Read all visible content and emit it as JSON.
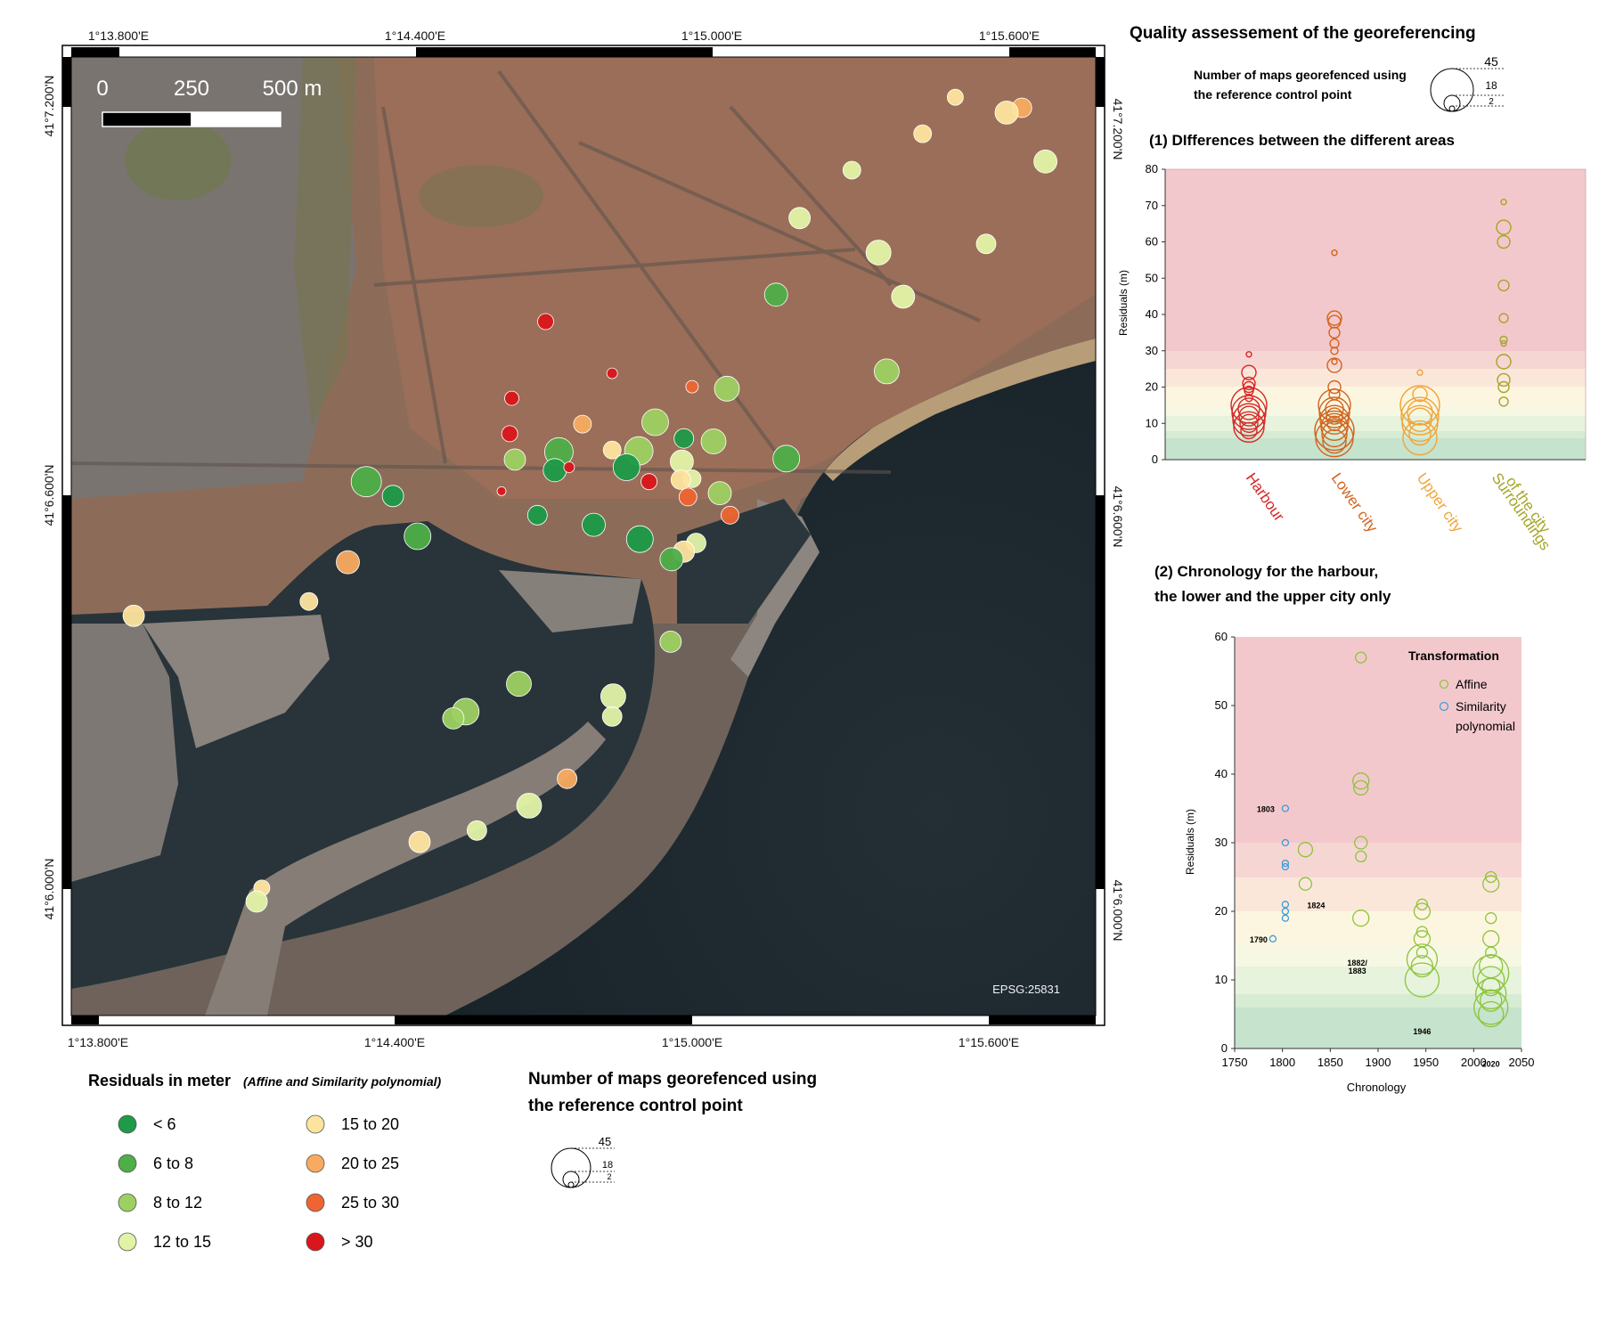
{
  "map": {
    "crs_label": "EPSG:25831",
    "lon_ticks": [
      "1°13.800'E",
      "1°14.400'E",
      "1°15.000'E",
      "1°15.600'E"
    ],
    "lat_ticks": [
      "41°7.200'N",
      "41°6.600'N",
      "41°6.000'N"
    ],
    "scalebar": {
      "labels": [
        "0",
        "250",
        "500 m"
      ]
    },
    "points": [
      {
        "x": 0.863,
        "y": 0.042,
        "c": 4
      },
      {
        "x": 0.928,
        "y": 0.053,
        "c": 5
      },
      {
        "x": 0.913,
        "y": 0.058,
        "c": 4
      },
      {
        "x": 0.831,
        "y": 0.08,
        "c": 4
      },
      {
        "x": 0.951,
        "y": 0.109,
        "c": 3
      },
      {
        "x": 0.762,
        "y": 0.118,
        "c": 3
      },
      {
        "x": 0.711,
        "y": 0.168,
        "c": 3
      },
      {
        "x": 0.788,
        "y": 0.204,
        "c": 3
      },
      {
        "x": 0.893,
        "y": 0.195,
        "c": 3
      },
      {
        "x": 0.812,
        "y": 0.25,
        "c": 3
      },
      {
        "x": 0.688,
        "y": 0.248,
        "c": 1
      },
      {
        "x": 0.796,
        "y": 0.328,
        "c": 2
      },
      {
        "x": 0.463,
        "y": 0.276,
        "c": 7
      },
      {
        "x": 0.528,
        "y": 0.33,
        "c": 7
      },
      {
        "x": 0.43,
        "y": 0.356,
        "c": 7
      },
      {
        "x": 0.606,
        "y": 0.344,
        "c": 6
      },
      {
        "x": 0.64,
        "y": 0.346,
        "c": 2
      },
      {
        "x": 0.428,
        "y": 0.393,
        "c": 7
      },
      {
        "x": 0.499,
        "y": 0.383,
        "c": 5
      },
      {
        "x": 0.57,
        "y": 0.381,
        "c": 2
      },
      {
        "x": 0.598,
        "y": 0.398,
        "c": 0
      },
      {
        "x": 0.627,
        "y": 0.401,
        "c": 2
      },
      {
        "x": 0.554,
        "y": 0.411,
        "c": 2
      },
      {
        "x": 0.528,
        "y": 0.41,
        "c": 4
      },
      {
        "x": 0.476,
        "y": 0.412,
        "c": 1
      },
      {
        "x": 0.433,
        "y": 0.42,
        "c": 2
      },
      {
        "x": 0.472,
        "y": 0.431,
        "c": 0
      },
      {
        "x": 0.542,
        "y": 0.428,
        "c": 0
      },
      {
        "x": 0.486,
        "y": 0.428,
        "c": 7
      },
      {
        "x": 0.596,
        "y": 0.422,
        "c": 3
      },
      {
        "x": 0.606,
        "y": 0.44,
        "c": 3
      },
      {
        "x": 0.595,
        "y": 0.441,
        "c": 4
      },
      {
        "x": 0.564,
        "y": 0.443,
        "c": 7
      },
      {
        "x": 0.633,
        "y": 0.455,
        "c": 2
      },
      {
        "x": 0.602,
        "y": 0.459,
        "c": 6
      },
      {
        "x": 0.42,
        "y": 0.453,
        "c": 7
      },
      {
        "x": 0.698,
        "y": 0.419,
        "c": 1
      },
      {
        "x": 0.288,
        "y": 0.443,
        "c": 1
      },
      {
        "x": 0.314,
        "y": 0.458,
        "c": 0
      },
      {
        "x": 0.643,
        "y": 0.478,
        "c": 6
      },
      {
        "x": 0.455,
        "y": 0.478,
        "c": 0
      },
      {
        "x": 0.51,
        "y": 0.488,
        "c": 0
      },
      {
        "x": 0.555,
        "y": 0.503,
        "c": 0
      },
      {
        "x": 0.61,
        "y": 0.507,
        "c": 3
      },
      {
        "x": 0.598,
        "y": 0.516,
        "c": 4
      },
      {
        "x": 0.586,
        "y": 0.524,
        "c": 1
      },
      {
        "x": 0.338,
        "y": 0.5,
        "c": 1
      },
      {
        "x": 0.27,
        "y": 0.527,
        "c": 5
      },
      {
        "x": 0.232,
        "y": 0.568,
        "c": 4
      },
      {
        "x": 0.061,
        "y": 0.583,
        "c": 4
      },
      {
        "x": 0.585,
        "y": 0.61,
        "c": 2
      },
      {
        "x": 0.437,
        "y": 0.654,
        "c": 2
      },
      {
        "x": 0.529,
        "y": 0.667,
        "c": 3
      },
      {
        "x": 0.528,
        "y": 0.688,
        "c": 3
      },
      {
        "x": 0.385,
        "y": 0.683,
        "c": 2
      },
      {
        "x": 0.373,
        "y": 0.69,
        "c": 2
      },
      {
        "x": 0.484,
        "y": 0.753,
        "c": 5
      },
      {
        "x": 0.447,
        "y": 0.781,
        "c": 3
      },
      {
        "x": 0.396,
        "y": 0.807,
        "c": 3
      },
      {
        "x": 0.34,
        "y": 0.819,
        "c": 4
      },
      {
        "x": 0.186,
        "y": 0.867,
        "c": 4
      },
      {
        "x": 0.181,
        "y": 0.881,
        "c": 3
      }
    ]
  },
  "right_panel": {
    "title": "Quality assessement of the georeferencing",
    "size_legend_text": [
      "Number of maps georefenced using",
      "the reference control point"
    ],
    "size_values": [
      "45",
      "18",
      "2"
    ],
    "chart1_title": "(1) DIfferences between the different areas",
    "chart2_title": [
      "(2) Chronology for the harbour,",
      "the lower and the upper city only"
    ]
  },
  "chart_data": [
    {
      "type": "scatter",
      "title": "(1) DIfferences between the different areas",
      "ylabel": "Residuals (m)",
      "ylim": [
        0,
        80
      ],
      "yticks": [
        "0",
        "10",
        "20",
        "30",
        "40",
        "50",
        "60",
        "70",
        "80"
      ],
      "categories": [
        "Harbour",
        "Lower city",
        "Upper city",
        "Surroundings of the city"
      ],
      "category_label_lines": [
        [
          "Harbour"
        ],
        [
          "Lower city"
        ],
        [
          "Upper city"
        ],
        [
          "Surroundings",
          "of the city"
        ]
      ],
      "category_colors": [
        "#d62728",
        "#d4631c",
        "#f0a43a",
        "#a5a528"
      ],
      "series": [
        {
          "category": "Harbour",
          "values": [
            29,
            24,
            21,
            20,
            19,
            17,
            15,
            14,
            13,
            12,
            11,
            10,
            9,
            8
          ]
        },
        {
          "category": "Lower city",
          "values": [
            57,
            39,
            38,
            35,
            32,
            30,
            27,
            26,
            20,
            18,
            15,
            14,
            13,
            12,
            11,
            10,
            9,
            8,
            7,
            6,
            5
          ]
        },
        {
          "category": "Upper city",
          "values": [
            24,
            18,
            15,
            13,
            12,
            11,
            10,
            7,
            6
          ]
        },
        {
          "category": "Surroundings of the city",
          "values": [
            71,
            64,
            60,
            48,
            39,
            33,
            32,
            27,
            22,
            20,
            16
          ]
        }
      ]
    },
    {
      "type": "scatter",
      "title": "(2) Chronology for the harbour, the lower and the upper city only",
      "xlabel": "Chronology",
      "ylabel": "Residuals (m)",
      "xlim": [
        1750,
        2050
      ],
      "ylim": [
        0,
        60
      ],
      "xticks": [
        "1750",
        "1800",
        "1850",
        "1900",
        "1950",
        "2000",
        "2050"
      ],
      "yticks": [
        "0",
        "10",
        "20",
        "30",
        "40",
        "50",
        "60"
      ],
      "legend_title": "Transformation",
      "legend_items": [
        "Affine",
        "Similarity",
        "polynomial"
      ],
      "annotations": [
        {
          "text": "1803",
          "x": 1803,
          "y": 35
        },
        {
          "text": "1824",
          "x": 1824,
          "y": 22
        },
        {
          "text": "1790",
          "x": 1790,
          "y": 16
        },
        {
          "text": "1882/",
          "x": 1882,
          "y": 16
        },
        {
          "text": "1883",
          "x": 1882,
          "y": 14
        },
        {
          "text": "1946",
          "x": 1946,
          "y": 6
        },
        {
          "text": "2020",
          "x": 2018,
          "y": 1
        }
      ],
      "series": [
        {
          "name": "Affine",
          "color": "#8cc43c",
          "points": [
            [
              1882,
              57
            ],
            [
              1882,
              39
            ],
            [
              1882,
              38
            ],
            [
              1882,
              30
            ],
            [
              1882,
              28
            ],
            [
              1882,
              19
            ],
            [
              1824,
              29
            ],
            [
              1824,
              24
            ],
            [
              1946,
              21
            ],
            [
              1946,
              20
            ],
            [
              1946,
              17
            ],
            [
              1946,
              16
            ],
            [
              1946,
              14
            ],
            [
              1946,
              13
            ],
            [
              1946,
              12
            ],
            [
              1946,
              10
            ],
            [
              2018,
              25
            ],
            [
              2018,
              24
            ],
            [
              2018,
              19
            ],
            [
              2018,
              16
            ],
            [
              2018,
              14
            ],
            [
              2018,
              12
            ],
            [
              2018,
              11
            ],
            [
              2018,
              10
            ],
            [
              2018,
              9
            ],
            [
              2018,
              8
            ],
            [
              2018,
              7
            ],
            [
              2018,
              6
            ],
            [
              2018,
              5
            ]
          ]
        },
        {
          "name": "Similarity polynomial",
          "color": "#3a9bd8",
          "points": [
            [
              1803,
              35
            ],
            [
              1803,
              30
            ],
            [
              1803,
              27
            ],
            [
              1803,
              26.5
            ],
            [
              1803,
              21
            ],
            [
              1803,
              20
            ],
            [
              1803,
              19
            ],
            [
              1790,
              16
            ]
          ]
        }
      ]
    }
  ],
  "legend": {
    "title": "Residuals in meter",
    "title_note": "(Affine and Similarity polynomial)",
    "classes": [
      {
        "label": "< 6",
        "color": "#1e9a48"
      },
      {
        "label": "6 to 8",
        "color": "#4eae48"
      },
      {
        "label": "8 to 12",
        "color": "#9dd062"
      },
      {
        "label": "12 to 15",
        "color": "#e1f3a6"
      },
      {
        "label": "15 to 20",
        "color": "#fde49e"
      },
      {
        "label": "20 to 25",
        "color": "#f8ab60"
      },
      {
        "label": "25 to 30",
        "color": "#ee6432"
      },
      {
        "label": "> 30",
        "color": "#d9161b"
      }
    ],
    "size_title": [
      "Number of maps georefenced using",
      "the reference control point"
    ],
    "size_values": [
      "45",
      "18",
      "2"
    ]
  }
}
